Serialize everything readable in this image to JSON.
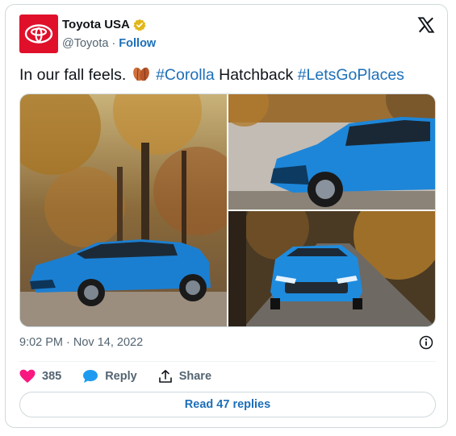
{
  "account": {
    "name": "Toyota USA",
    "handle": "@Toyota",
    "separator": "·",
    "follow_label": "Follow",
    "avatar_icon": "toyota-logo-icon",
    "verified_icon": "verified-badge-icon",
    "verified_color": "#e2b719",
    "avatar_color": "#e0102b"
  },
  "platform": {
    "logo_icon": "x-logo-icon"
  },
  "tweet": {
    "text_prefix": "In our fall feels.",
    "emoji_icon": "fallen-leaf-icon",
    "hashtag_1": "#Corolla",
    "text_middle": "Hatchback",
    "hashtag_2": "#LetsGoPlaces",
    "link_color": "#1d6fb8"
  },
  "media": {
    "photos": [
      {
        "name": "photo-hatchback-side-autumn-trees"
      },
      {
        "name": "photo-hatchback-front-by-lake"
      },
      {
        "name": "photo-hatchback-front-on-forest-road"
      }
    ]
  },
  "meta": {
    "timestamp": "9:02 PM · Nov 14, 2022",
    "info_icon": "info-icon"
  },
  "actions": {
    "like_count": "385",
    "reply_label": "Reply",
    "share_label": "Share",
    "like_icon": "heart-icon",
    "reply_icon": "speech-bubble-icon",
    "share_icon": "share-upload-icon",
    "like_color": "#f91880",
    "reply_color": "#1d9bf0"
  },
  "replies": {
    "button_label": "Read 47 replies"
  }
}
